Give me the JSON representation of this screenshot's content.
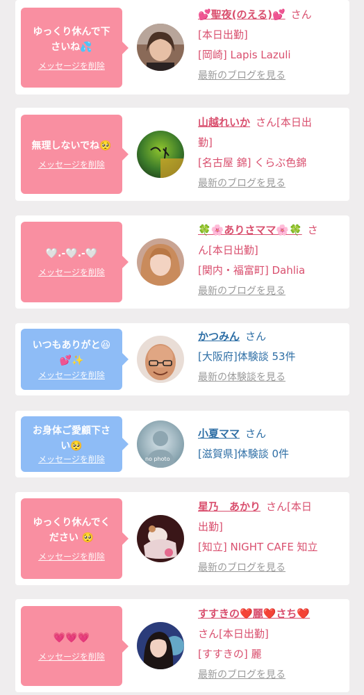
{
  "cards": [
    {
      "message_line1": "ゆっくり休んで下",
      "message_line2": "さいね💦",
      "delete_label": "メッセージを削除",
      "name": "💕聖夜(のえる)💕",
      "san": "さん",
      "line2": "[本日出勤]",
      "line3": "[岡崎] Lapis Lazuli",
      "link": "最新のブログを見る"
    },
    {
      "message_line1": "無理しないでね🥺",
      "delete_label": "メッセージを削除",
      "name": "山越れいか",
      "san": "さん[本日出",
      "line2": "勤]",
      "line3": "[名古屋 錦] くらぶ色錦",
      "link": "最新のブログを見る"
    },
    {
      "message_line1": "🤍.-🤍.-🤍",
      "delete_label": "メッセージを削除",
      "name": "🍀🌸ありさママ🌸🍀",
      "san": "さ",
      "line2": "ん[本日出勤]",
      "line3": "[関内・福富町] Dahlia",
      "link": "最新のブログを見る"
    },
    {
      "message_line1": "いつもありがと😆",
      "message_line2": "💕✨",
      "delete_label": "メッセージを削除",
      "name": "かつみん",
      "san": "さん",
      "line2": "[大阪府]体験談 53件",
      "link": "最新の体験談を見る"
    },
    {
      "message_line1": "お身体ご愛顧下さ",
      "message_line2": "い🥺",
      "delete_label": "メッセージを削除",
      "name": "小夏ママ",
      "san": "さん",
      "line2": "[滋賀県]体験談 0件",
      "avatar_text": "no photo"
    },
    {
      "message_line1": "ゆっくり休んでく",
      "message_line2": "ださい 🥺",
      "delete_label": "メッセージを削除",
      "name": "星乃　あかり",
      "san": "さん[本日",
      "line2": "出勤]",
      "line3": "[知立] NIGHT CAFE 知立",
      "link": "最新のブログを見る"
    },
    {
      "message_line1": "💗💗💗",
      "delete_label": "メッセージを削除",
      "name_part1": "すすきの",
      "name_heart": "❤️",
      "name_part2": "麗",
      "name_part3": "さち",
      "line1": "さん[本日出勤]",
      "line2": "[すすきの] 麗",
      "link": "最新のブログを見る"
    }
  ]
}
